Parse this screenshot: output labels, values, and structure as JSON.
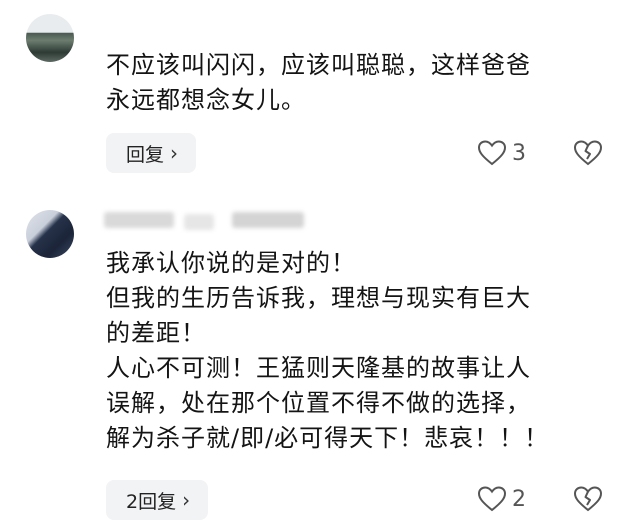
{
  "comments": [
    {
      "text": "不应该叫闪闪，应该叫聪聪，这样爸爸\n永远都想念女儿。",
      "reply_label": "回复",
      "reply_chevron": "›",
      "like_count": "3",
      "icons": {
        "like": "heart-outline-icon",
        "dislike": "broken-heart-icon"
      }
    },
    {
      "text": "我承认你说的是对的！\n但我的生历告诉我，理想与现实有巨大\n的差距！\n人心不可测！王猛则天隆基的故事让人\n误解，处在那个位置不得不做的选择，\n解为杀子就/即/必可得天下！悲哀！！！",
      "reply_label": "2回复",
      "reply_chevron": "›",
      "like_count": "2",
      "icons": {
        "like": "heart-outline-icon",
        "dislike": "broken-heart-icon"
      }
    }
  ],
  "colors": {
    "reply_bg": "#f2f3f5",
    "text": "#141414",
    "icon": "#555555"
  }
}
